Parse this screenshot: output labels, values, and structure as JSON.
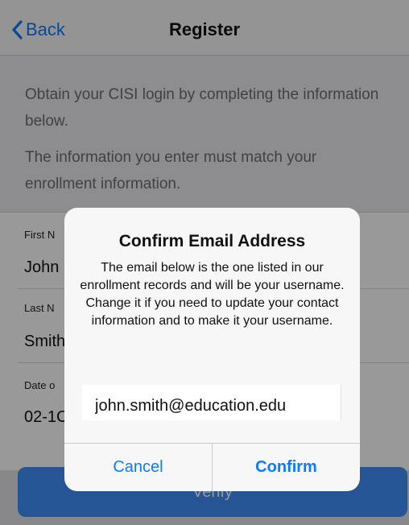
{
  "navbar": {
    "back_label": "Back",
    "title": "Register"
  },
  "intro": {
    "line1": "Obtain your CISI login by completing the information below.",
    "line2": "The information you enter must match your enrollment information."
  },
  "form": {
    "fields": [
      {
        "label": "First N",
        "value": "John"
      },
      {
        "label": "Last N",
        "value": "Smith"
      },
      {
        "label": "Date o",
        "value": "02-1C"
      }
    ],
    "verify_label": "Verify"
  },
  "alert": {
    "title": "Confirm Email Address",
    "message": "The email below is the one listed in our enrollment records and will be your username. Change it if you need to update your contact information and to make it your username.",
    "email_value": "john.smith@education.edu",
    "cancel_label": "Cancel",
    "confirm_label": "Confirm"
  },
  "colors": {
    "accent": "#0a7aff",
    "verify_button": "#3f8ef7"
  },
  "icons": {
    "back": "chevron-left-icon"
  }
}
